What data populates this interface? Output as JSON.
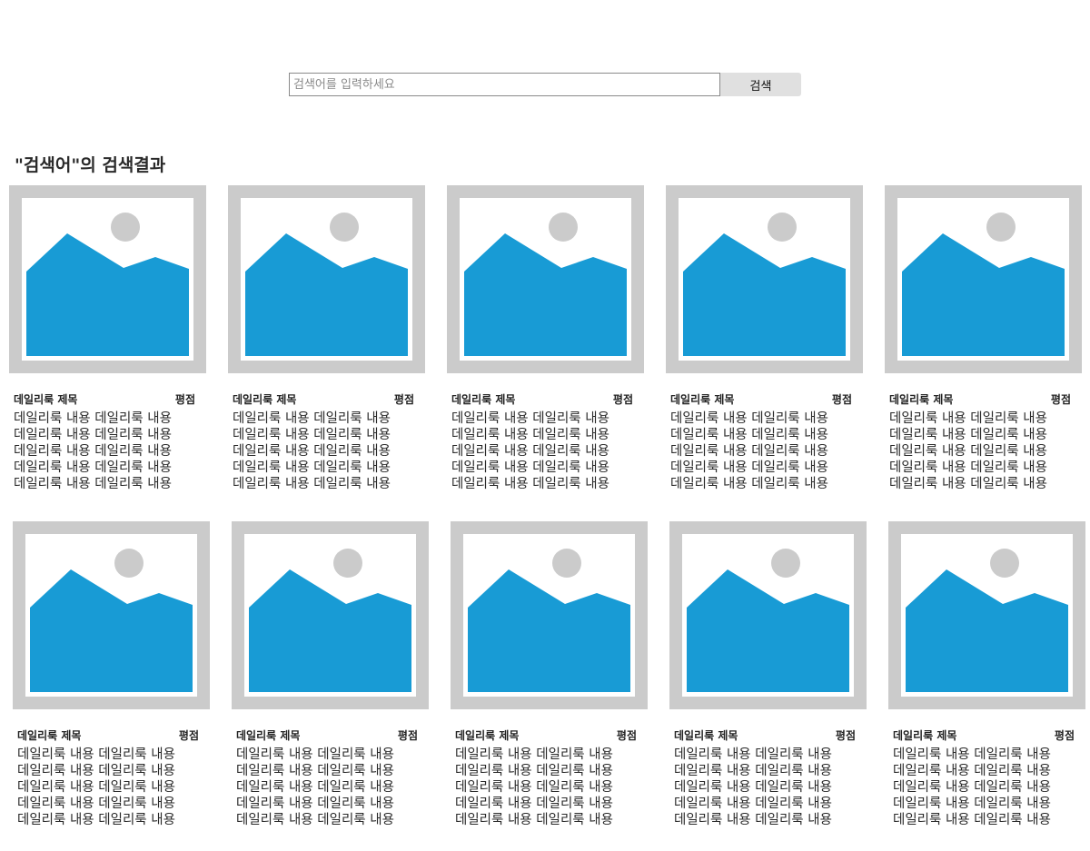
{
  "search": {
    "placeholder": "검색어를 입력하세요",
    "value": "",
    "button_label": "검색"
  },
  "results": {
    "title": "\"검색어\"의 검색결과"
  },
  "colors": {
    "thumb_frame": "#cbcbcb",
    "thumb_mountain": "#189bd5",
    "thumb_sun": "#cbcbcb"
  },
  "cards": [
    {
      "title": "데일리룩 제목",
      "rating": "평점",
      "lines": [
        "데일리룩 내용 데일리룩 내용",
        "데일리룩 내용 데일리룩 내용",
        "데일리룩 내용 데일리룩 내용",
        "데일리룩 내용 데일리룩 내용",
        "데일리룩 내용 데일리룩 내용"
      ]
    },
    {
      "title": "데일리룩 제목",
      "rating": "평점",
      "lines": [
        "데일리룩 내용 데일리룩 내용",
        "데일리룩 내용 데일리룩 내용",
        "데일리룩 내용 데일리룩 내용",
        "데일리룩 내용 데일리룩 내용",
        "데일리룩 내용 데일리룩 내용"
      ]
    },
    {
      "title": "데일리룩 제목",
      "rating": "평점",
      "lines": [
        "데일리룩 내용 데일리룩 내용",
        "데일리룩 내용 데일리룩 내용",
        "데일리룩 내용 데일리룩 내용",
        "데일리룩 내용 데일리룩 내용",
        "데일리룩 내용 데일리룩 내용"
      ]
    },
    {
      "title": "데일리룩 제목",
      "rating": "평점",
      "lines": [
        "데일리룩 내용 데일리룩 내용",
        "데일리룩 내용 데일리룩 내용",
        "데일리룩 내용 데일리룩 내용",
        "데일리룩 내용 데일리룩 내용",
        "데일리룩 내용 데일리룩 내용"
      ]
    },
    {
      "title": "데일리룩 제목",
      "rating": "평점",
      "lines": [
        "데일리룩 내용 데일리룩 내용",
        "데일리룩 내용 데일리룩 내용",
        "데일리룩 내용 데일리룩 내용",
        "데일리룩 내용 데일리룩 내용",
        "데일리룩 내용 데일리룩 내용"
      ]
    },
    {
      "title": "데일리룩 제목",
      "rating": "평점",
      "lines": [
        "데일리룩 내용 데일리룩 내용",
        "데일리룩 내용 데일리룩 내용",
        "데일리룩 내용 데일리룩 내용",
        "데일리룩 내용 데일리룩 내용",
        "데일리룩 내용 데일리룩 내용"
      ]
    },
    {
      "title": "데일리룩 제목",
      "rating": "평점",
      "lines": [
        "데일리룩 내용 데일리룩 내용",
        "데일리룩 내용 데일리룩 내용",
        "데일리룩 내용 데일리룩 내용",
        "데일리룩 내용 데일리룩 내용",
        "데일리룩 내용 데일리룩 내용"
      ]
    },
    {
      "title": "데일리룩 제목",
      "rating": "평점",
      "lines": [
        "데일리룩 내용 데일리룩 내용",
        "데일리룩 내용 데일리룩 내용",
        "데일리룩 내용 데일리룩 내용",
        "데일리룩 내용 데일리룩 내용",
        "데일리룩 내용 데일리룩 내용"
      ]
    },
    {
      "title": "데일리룩 제목",
      "rating": "평점",
      "lines": [
        "데일리룩 내용 데일리룩 내용",
        "데일리룩 내용 데일리룩 내용",
        "데일리룩 내용 데일리룩 내용",
        "데일리룩 내용 데일리룩 내용",
        "데일리룩 내용 데일리룩 내용"
      ]
    },
    {
      "title": "데일리룩 제목",
      "rating": "평점",
      "lines": [
        "데일리룩 내용 데일리룩 내용",
        "데일리룩 내용 데일리룩 내용",
        "데일리룩 내용 데일리룩 내용",
        "데일리룩 내용 데일리룩 내용",
        "데일리룩 내용 데일리룩 내용"
      ]
    }
  ]
}
